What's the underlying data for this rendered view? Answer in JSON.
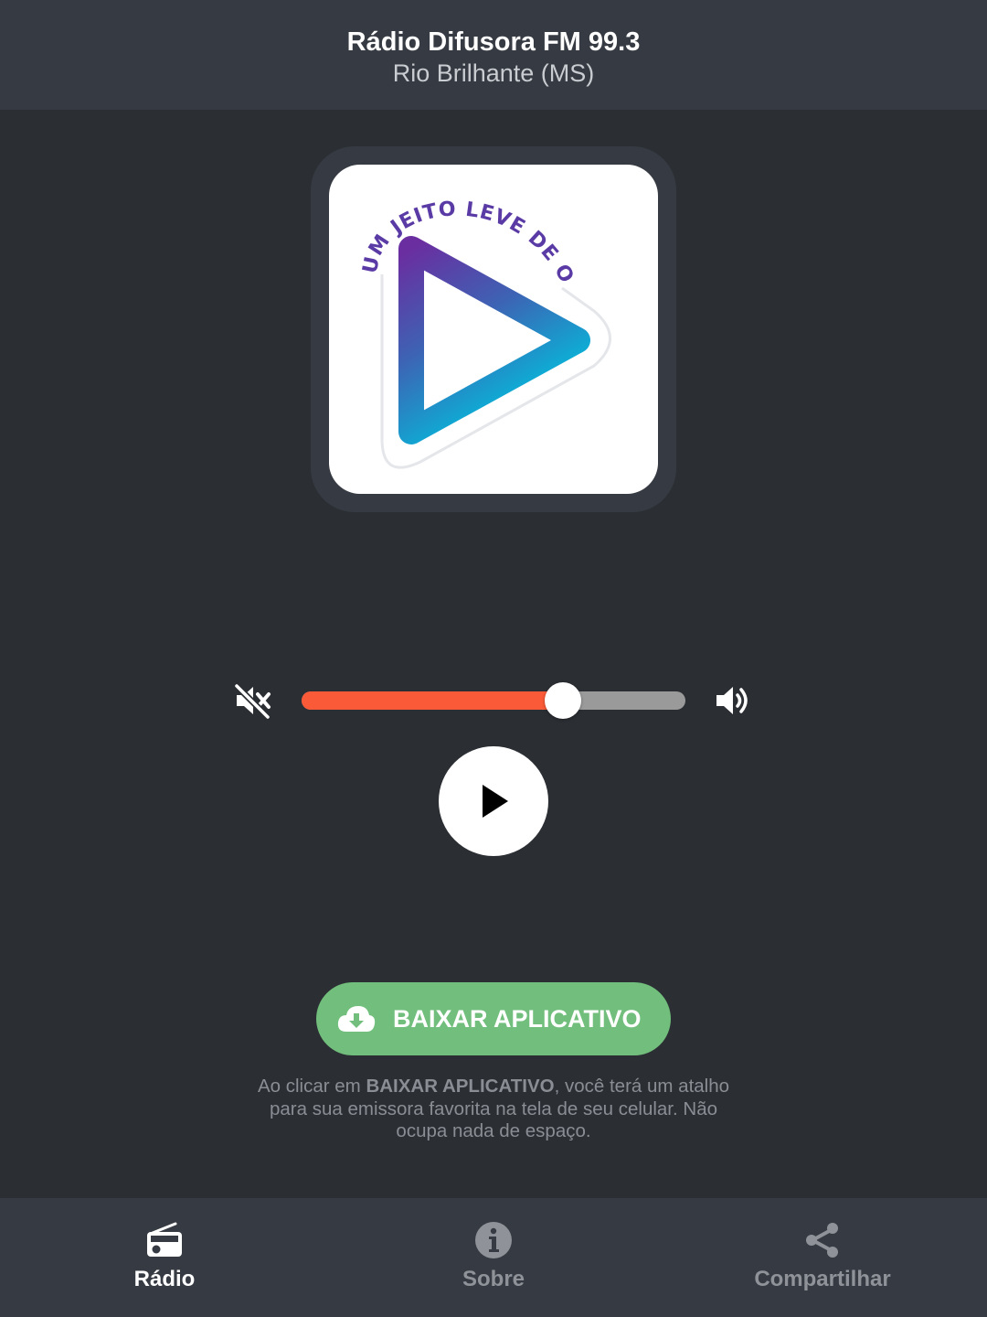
{
  "header": {
    "title": "Rádio Difusora FM 99.3",
    "subtitle": "Rio Brilhante (MS)"
  },
  "logo": {
    "tagline": "UM JEITO LEVE DE OUVIR",
    "gradient_top": "#6a2ea0",
    "gradient_bottom": "#00c2de"
  },
  "player": {
    "volume_percent": 68,
    "accent_color": "#fa5a37",
    "mute_icon": "volume-mute-icon",
    "volume_icon": "volume-up-icon",
    "play_icon": "play-icon"
  },
  "download": {
    "label": "BAIXAR APLICATIVO",
    "icon": "cloud-download-icon",
    "color": "#72bf7d",
    "hint_before": "Ao clicar em ",
    "hint_bold": "BAIXAR APLICATIVO",
    "hint_after": ", você terá um atalho para sua emissora favorita na tela de seu celular. Não ocupa nada de espaço."
  },
  "nav": {
    "items": [
      {
        "label": "Rádio",
        "icon": "radio-icon",
        "active": true
      },
      {
        "label": "Sobre",
        "icon": "info-icon",
        "active": false
      },
      {
        "label": "Compartilhar",
        "icon": "share-icon",
        "active": false
      }
    ]
  }
}
